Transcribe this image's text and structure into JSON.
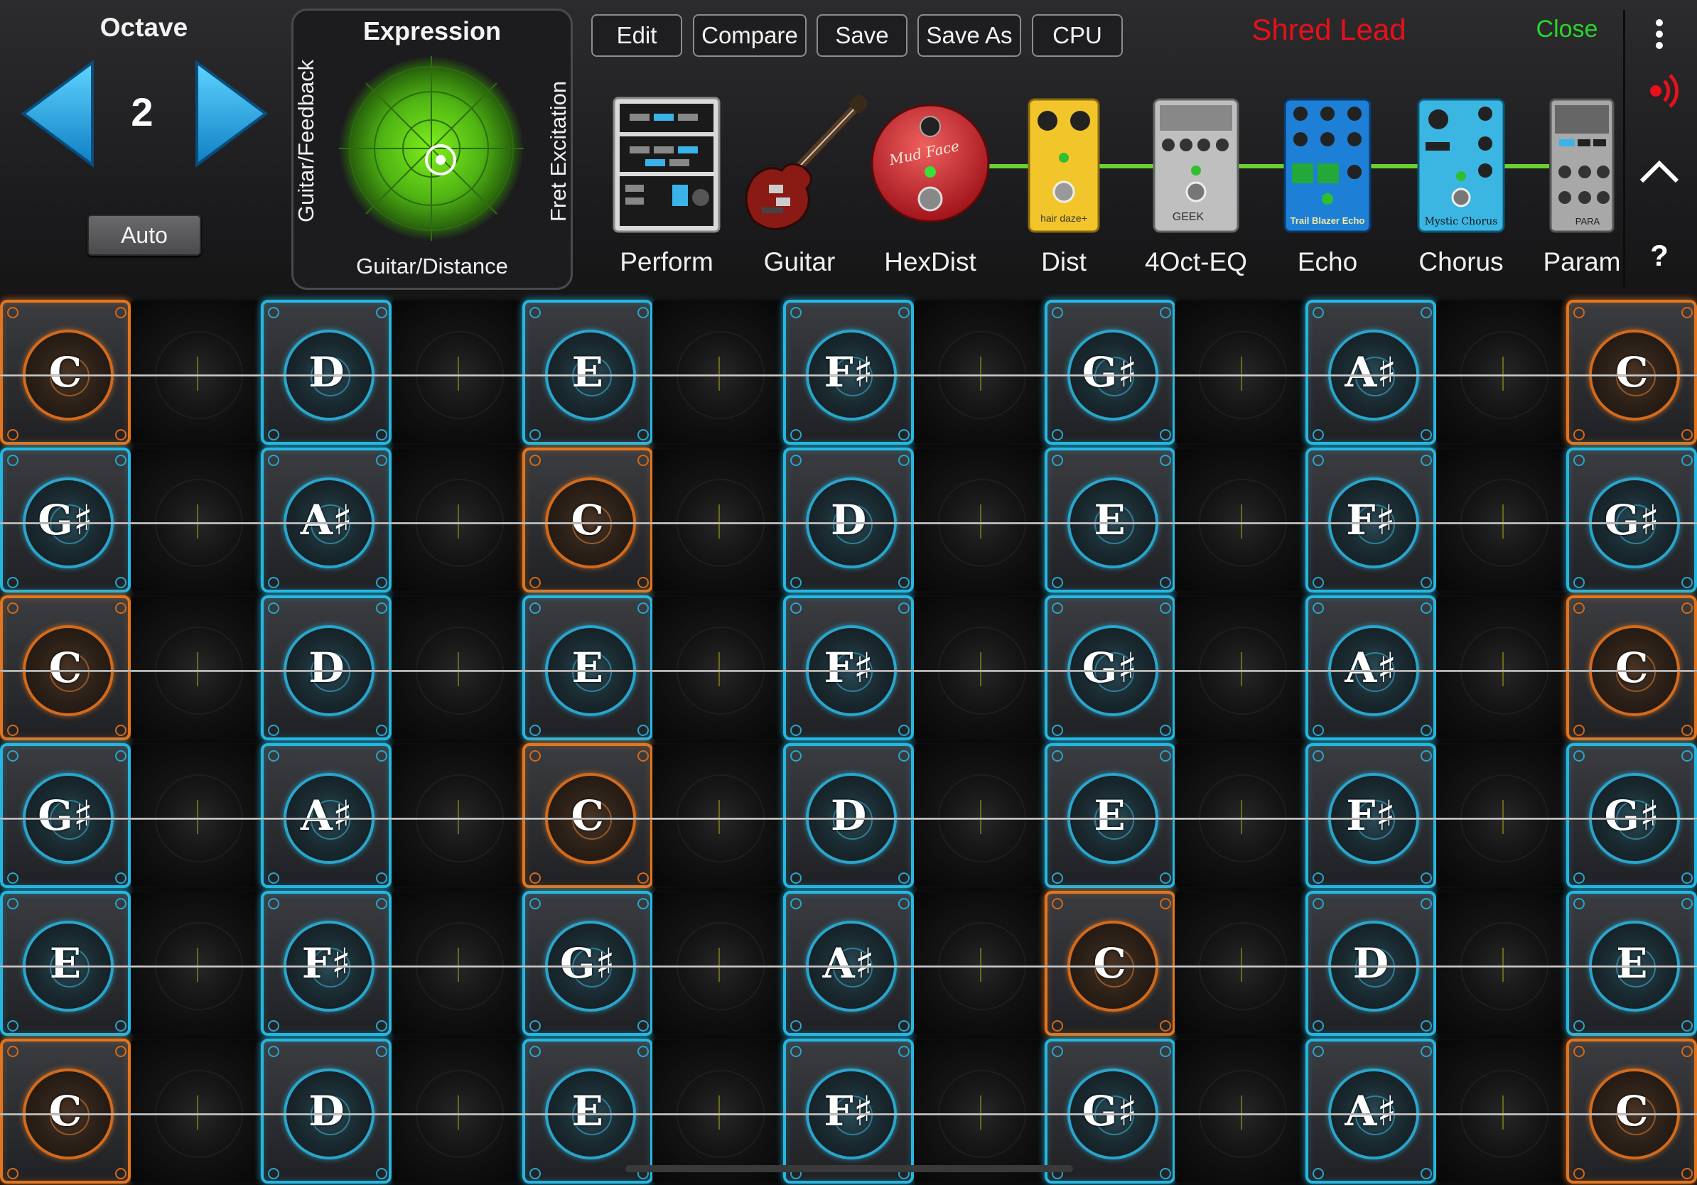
{
  "octave": {
    "title": "Octave",
    "value": "2",
    "auto_label": "Auto"
  },
  "expression": {
    "title": "Expression",
    "x_label": "Guitar/Distance",
    "left_label": "Guitar/Feedback",
    "right_label": "Fret Excitation"
  },
  "toolbar": {
    "edit": "Edit",
    "compare": "Compare",
    "save": "Save",
    "save_as": "Save As",
    "cpu": "CPU"
  },
  "preset_name": "Shred Lead",
  "close_label": "Close",
  "help_label": "?",
  "modules": [
    {
      "label": "Perform",
      "icon": "perform-panel-icon"
    },
    {
      "label": "Guitar",
      "icon": "electric-guitar-icon"
    },
    {
      "label": "HexDist",
      "icon": "fuzz-pedal-icon"
    },
    {
      "label": "Dist",
      "icon": "distortion-pedal-icon"
    },
    {
      "label": "4Oct-EQ",
      "icon": "eq-pedal-icon"
    },
    {
      "label": "Echo",
      "icon": "echo-pedal-icon"
    },
    {
      "label": "Chorus",
      "icon": "chorus-pedal-icon"
    },
    {
      "label": "Param",
      "icon": "param-eq-pedal-icon"
    }
  ],
  "pedal_texts": {
    "hexdist": "Mud Face",
    "dist": "hair daze+",
    "eq": "GEEK",
    "echo": "Trail Blazer Echo",
    "chorus": "Mystic Chorus",
    "param": "PARA"
  },
  "colors": {
    "active_border": "#25b7e0",
    "root_border": "#e2751f",
    "preset_name": "#e8101a",
    "close": "#2ad62a",
    "chain": "#6bd12e"
  },
  "grid": {
    "rows": [
      [
        {
          "note": "C",
          "root": true
        },
        null,
        {
          "note": "D"
        },
        null,
        {
          "note": "E"
        },
        null,
        {
          "note": "F♯"
        },
        null,
        {
          "note": "G♯"
        },
        null,
        {
          "note": "A♯"
        },
        null,
        {
          "note": "C",
          "root": true
        }
      ],
      [
        {
          "note": "G♯"
        },
        null,
        {
          "note": "A♯"
        },
        null,
        {
          "note": "C",
          "root": true
        },
        null,
        {
          "note": "D"
        },
        null,
        {
          "note": "E"
        },
        null,
        {
          "note": "F♯"
        },
        null,
        {
          "note": "G♯"
        }
      ],
      [
        {
          "note": "C",
          "root": true
        },
        null,
        {
          "note": "D"
        },
        null,
        {
          "note": "E"
        },
        null,
        {
          "note": "F♯"
        },
        null,
        {
          "note": "G♯"
        },
        null,
        {
          "note": "A♯"
        },
        null,
        {
          "note": "C",
          "root": true
        }
      ],
      [
        {
          "note": "G♯"
        },
        null,
        {
          "note": "A♯"
        },
        null,
        {
          "note": "C",
          "root": true
        },
        null,
        {
          "note": "D"
        },
        null,
        {
          "note": "E"
        },
        null,
        {
          "note": "F♯"
        },
        null,
        {
          "note": "G♯"
        }
      ],
      [
        {
          "note": "E"
        },
        null,
        {
          "note": "F♯"
        },
        null,
        {
          "note": "G♯"
        },
        null,
        {
          "note": "A♯"
        },
        null,
        {
          "note": "C",
          "root": true
        },
        null,
        {
          "note": "D"
        },
        null,
        {
          "note": "E"
        }
      ],
      [
        {
          "note": "C",
          "root": true
        },
        null,
        {
          "note": "D"
        },
        null,
        {
          "note": "E"
        },
        null,
        {
          "note": "F♯"
        },
        null,
        {
          "note": "G♯"
        },
        null,
        {
          "note": "A♯"
        },
        null,
        {
          "note": "C",
          "root": true
        }
      ]
    ]
  }
}
